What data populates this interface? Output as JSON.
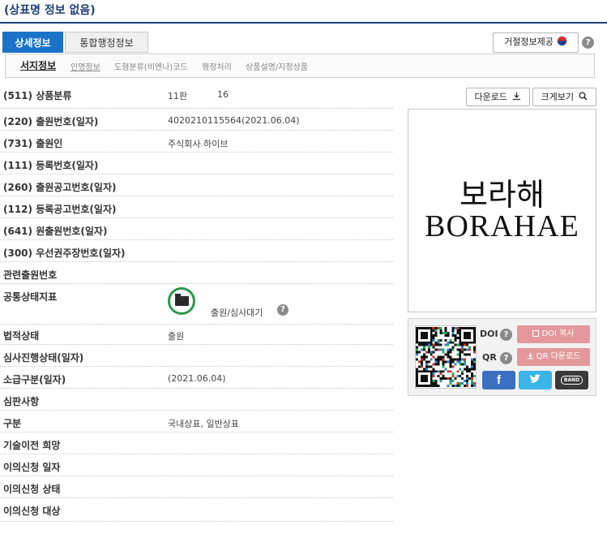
{
  "page_title": "(상표명 정보 없음)",
  "main_tabs": [
    "상세정보",
    "통합행정정보"
  ],
  "refusal_button": "거절정보제공",
  "help_mark": "?",
  "sub_tabs": [
    "서지정보",
    "인명정보",
    "도형분류(비엔나)코드",
    "행정처리",
    "상품설명/지정상품"
  ],
  "rows": [
    {
      "label": "(511) 상품분류",
      "value": "11판",
      "value2": "16"
    },
    {
      "label": "(220) 출원번호(일자)",
      "value": "4020210115564(2021.06.04)"
    },
    {
      "label": "(731) 출원인",
      "value": "주식회사 하이브"
    },
    {
      "label": "(111) 등록번호(일자)",
      "value": ""
    },
    {
      "label": "(260) 출원공고번호(일자)",
      "value": ""
    },
    {
      "label": "(112) 등록공고번호(일자)",
      "value": ""
    },
    {
      "label": "(641) 원출원번호(일자)",
      "value": ""
    },
    {
      "label": "(300) 우선권주장번호(일자)",
      "value": ""
    },
    {
      "label": "관련출원번호",
      "value": ""
    },
    {
      "label": "공통상태지표",
      "value": "출원/심사대기"
    },
    {
      "label": "법적상태",
      "value": "출원"
    },
    {
      "label": "심사진행상태(일자)",
      "value": ""
    },
    {
      "label": "소급구분(일자)",
      "value": "(2021.06.04)"
    },
    {
      "label": "심판사항",
      "value": ""
    },
    {
      "label": "구분",
      "value": "국내상표, 일반상표"
    },
    {
      "label": "기술이전 희망",
      "value": ""
    },
    {
      "label": "이의신청 일자",
      "value": ""
    },
    {
      "label": "이의신청 상태",
      "value": ""
    },
    {
      "label": "이의신청 대상",
      "value": ""
    }
  ],
  "download_button": "다운로드",
  "zoom_button": "크게보기",
  "mark": {
    "korean": "보라해",
    "english": "BORAHAE"
  },
  "share": {
    "doi_label": "DOI",
    "qr_label": "QR",
    "doi_copy": "DOI 복사",
    "qr_download": "QR 다운로드",
    "facebook": "f",
    "band": "BAND"
  },
  "icons": [
    "korea-flag-icon",
    "help-icon",
    "download-icon",
    "magnifier-icon",
    "folder-icon",
    "link-icon",
    "twitter-icon"
  ]
}
